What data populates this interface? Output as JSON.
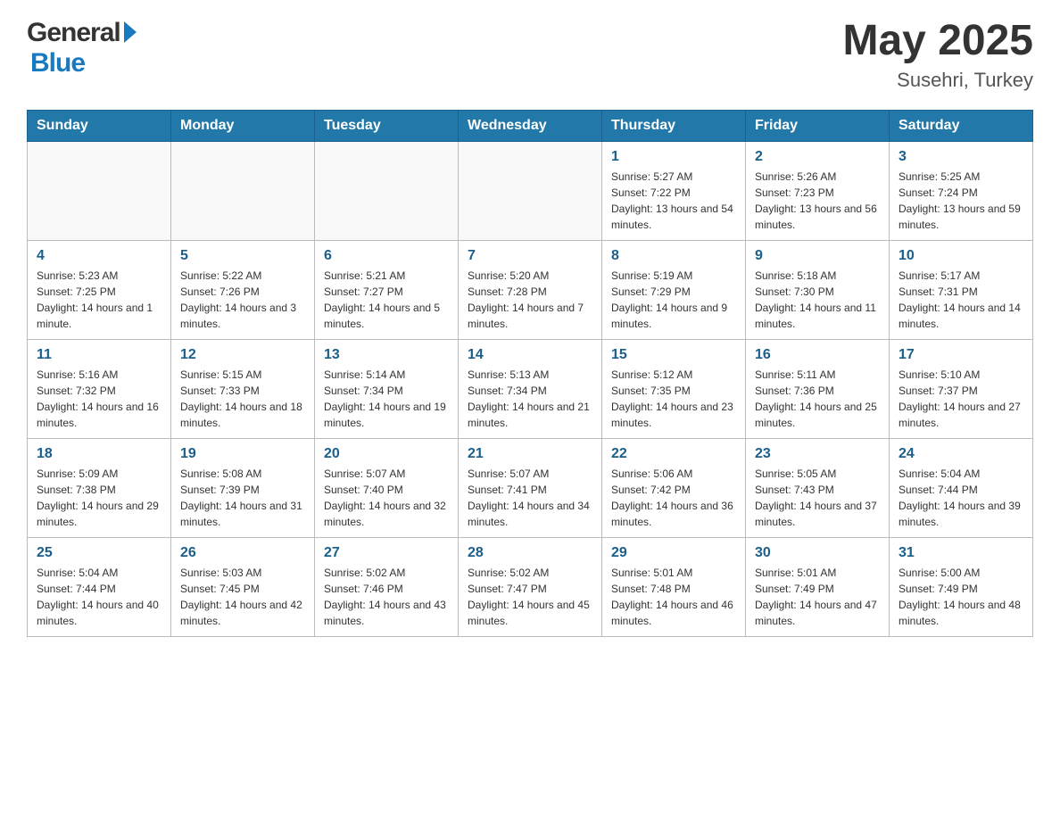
{
  "header": {
    "logo": {
      "general": "General",
      "blue": "Blue"
    },
    "month_year": "May 2025",
    "location": "Susehri, Turkey"
  },
  "days_of_week": [
    "Sunday",
    "Monday",
    "Tuesday",
    "Wednesday",
    "Thursday",
    "Friday",
    "Saturday"
  ],
  "weeks": [
    [
      {
        "day": "",
        "info": ""
      },
      {
        "day": "",
        "info": ""
      },
      {
        "day": "",
        "info": ""
      },
      {
        "day": "",
        "info": ""
      },
      {
        "day": "1",
        "info": "Sunrise: 5:27 AM\nSunset: 7:22 PM\nDaylight: 13 hours and 54 minutes."
      },
      {
        "day": "2",
        "info": "Sunrise: 5:26 AM\nSunset: 7:23 PM\nDaylight: 13 hours and 56 minutes."
      },
      {
        "day": "3",
        "info": "Sunrise: 5:25 AM\nSunset: 7:24 PM\nDaylight: 13 hours and 59 minutes."
      }
    ],
    [
      {
        "day": "4",
        "info": "Sunrise: 5:23 AM\nSunset: 7:25 PM\nDaylight: 14 hours and 1 minute."
      },
      {
        "day": "5",
        "info": "Sunrise: 5:22 AM\nSunset: 7:26 PM\nDaylight: 14 hours and 3 minutes."
      },
      {
        "day": "6",
        "info": "Sunrise: 5:21 AM\nSunset: 7:27 PM\nDaylight: 14 hours and 5 minutes."
      },
      {
        "day": "7",
        "info": "Sunrise: 5:20 AM\nSunset: 7:28 PM\nDaylight: 14 hours and 7 minutes."
      },
      {
        "day": "8",
        "info": "Sunrise: 5:19 AM\nSunset: 7:29 PM\nDaylight: 14 hours and 9 minutes."
      },
      {
        "day": "9",
        "info": "Sunrise: 5:18 AM\nSunset: 7:30 PM\nDaylight: 14 hours and 11 minutes."
      },
      {
        "day": "10",
        "info": "Sunrise: 5:17 AM\nSunset: 7:31 PM\nDaylight: 14 hours and 14 minutes."
      }
    ],
    [
      {
        "day": "11",
        "info": "Sunrise: 5:16 AM\nSunset: 7:32 PM\nDaylight: 14 hours and 16 minutes."
      },
      {
        "day": "12",
        "info": "Sunrise: 5:15 AM\nSunset: 7:33 PM\nDaylight: 14 hours and 18 minutes."
      },
      {
        "day": "13",
        "info": "Sunrise: 5:14 AM\nSunset: 7:34 PM\nDaylight: 14 hours and 19 minutes."
      },
      {
        "day": "14",
        "info": "Sunrise: 5:13 AM\nSunset: 7:34 PM\nDaylight: 14 hours and 21 minutes."
      },
      {
        "day": "15",
        "info": "Sunrise: 5:12 AM\nSunset: 7:35 PM\nDaylight: 14 hours and 23 minutes."
      },
      {
        "day": "16",
        "info": "Sunrise: 5:11 AM\nSunset: 7:36 PM\nDaylight: 14 hours and 25 minutes."
      },
      {
        "day": "17",
        "info": "Sunrise: 5:10 AM\nSunset: 7:37 PM\nDaylight: 14 hours and 27 minutes."
      }
    ],
    [
      {
        "day": "18",
        "info": "Sunrise: 5:09 AM\nSunset: 7:38 PM\nDaylight: 14 hours and 29 minutes."
      },
      {
        "day": "19",
        "info": "Sunrise: 5:08 AM\nSunset: 7:39 PM\nDaylight: 14 hours and 31 minutes."
      },
      {
        "day": "20",
        "info": "Sunrise: 5:07 AM\nSunset: 7:40 PM\nDaylight: 14 hours and 32 minutes."
      },
      {
        "day": "21",
        "info": "Sunrise: 5:07 AM\nSunset: 7:41 PM\nDaylight: 14 hours and 34 minutes."
      },
      {
        "day": "22",
        "info": "Sunrise: 5:06 AM\nSunset: 7:42 PM\nDaylight: 14 hours and 36 minutes."
      },
      {
        "day": "23",
        "info": "Sunrise: 5:05 AM\nSunset: 7:43 PM\nDaylight: 14 hours and 37 minutes."
      },
      {
        "day": "24",
        "info": "Sunrise: 5:04 AM\nSunset: 7:44 PM\nDaylight: 14 hours and 39 minutes."
      }
    ],
    [
      {
        "day": "25",
        "info": "Sunrise: 5:04 AM\nSunset: 7:44 PM\nDaylight: 14 hours and 40 minutes."
      },
      {
        "day": "26",
        "info": "Sunrise: 5:03 AM\nSunset: 7:45 PM\nDaylight: 14 hours and 42 minutes."
      },
      {
        "day": "27",
        "info": "Sunrise: 5:02 AM\nSunset: 7:46 PM\nDaylight: 14 hours and 43 minutes."
      },
      {
        "day": "28",
        "info": "Sunrise: 5:02 AM\nSunset: 7:47 PM\nDaylight: 14 hours and 45 minutes."
      },
      {
        "day": "29",
        "info": "Sunrise: 5:01 AM\nSunset: 7:48 PM\nDaylight: 14 hours and 46 minutes."
      },
      {
        "day": "30",
        "info": "Sunrise: 5:01 AM\nSunset: 7:49 PM\nDaylight: 14 hours and 47 minutes."
      },
      {
        "day": "31",
        "info": "Sunrise: 5:00 AM\nSunset: 7:49 PM\nDaylight: 14 hours and 48 minutes."
      }
    ]
  ]
}
